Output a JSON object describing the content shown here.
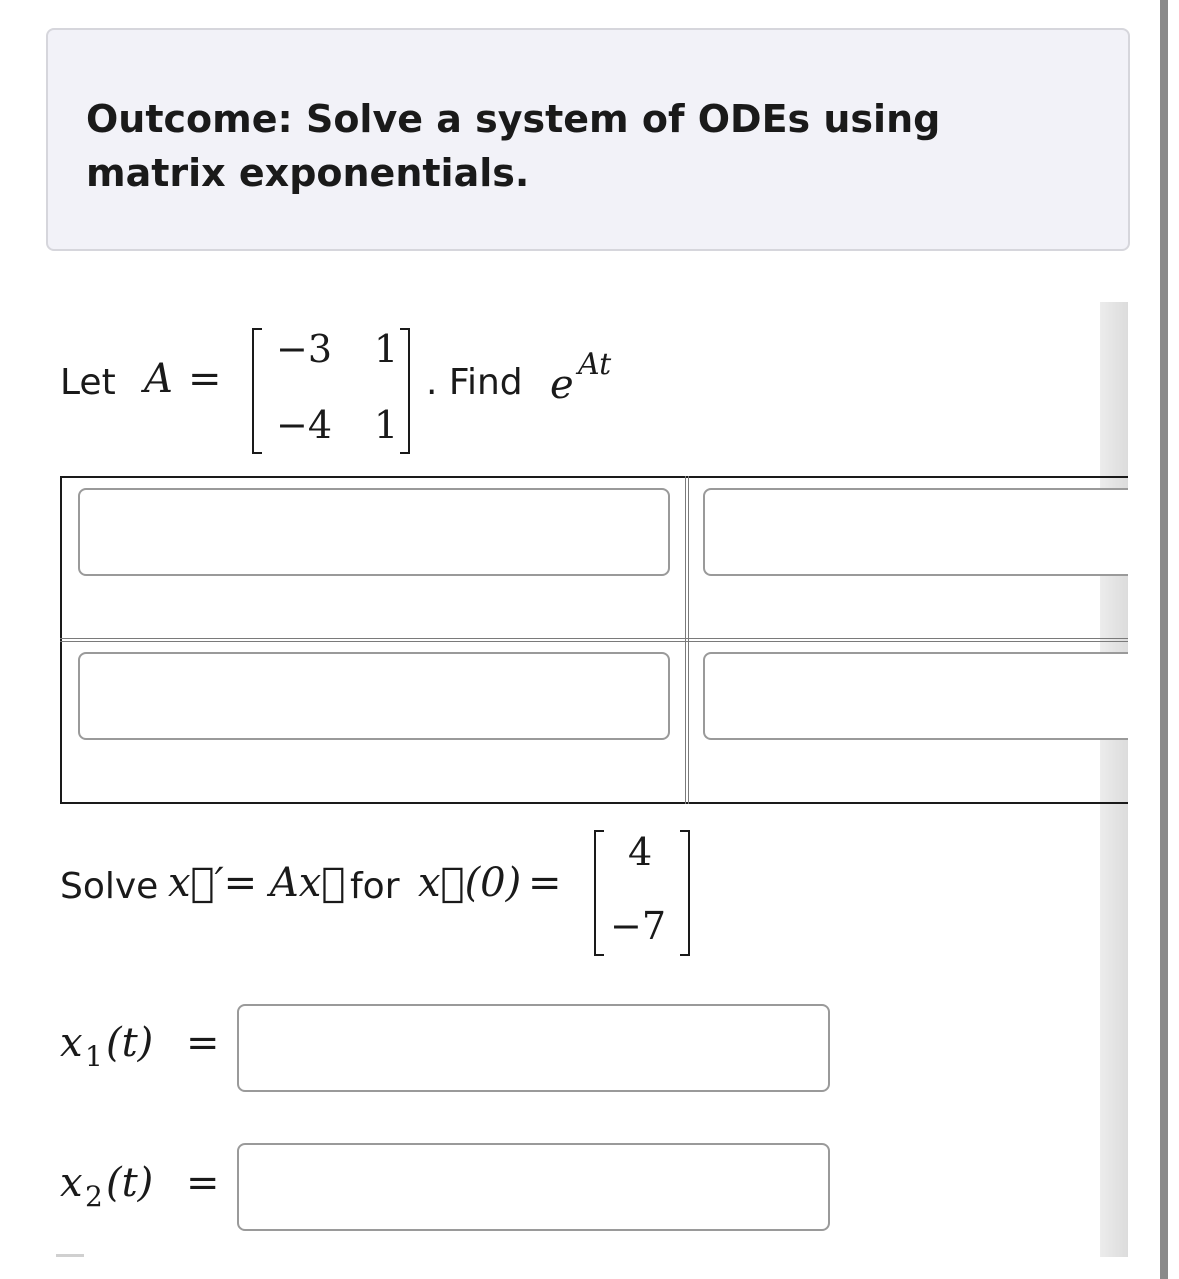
{
  "outcome": {
    "text": "Outcome: Solve a system of ODEs using matrix exponentials."
  },
  "question1": {
    "let_word": "Let",
    "matrix_name": "A",
    "equals": "=",
    "matrix": [
      [
        "−3",
        "1"
      ],
      [
        "−4",
        "1"
      ]
    ],
    "find_text": ". Find",
    "exp_base": "e",
    "exp_power": "At"
  },
  "answer_matrix": {
    "cells": [
      {
        "value": "",
        "placeholder": ""
      },
      {
        "value": "",
        "placeholder": ""
      },
      {
        "value": "",
        "placeholder": ""
      },
      {
        "value": "",
        "placeholder": ""
      }
    ]
  },
  "question2": {
    "solve_word": "Solve",
    "equation": "x⃗′= Ax⃗",
    "for_word": "for",
    "initial": "x⃗(0)",
    "equals": "=",
    "vector": [
      "4",
      "−7"
    ]
  },
  "answers": {
    "x1": {
      "label": "x",
      "sub": "1",
      "arg": "(t)",
      "equals": "=",
      "value": ""
    },
    "x2": {
      "label": "x",
      "sub": "2",
      "arg": "(t)",
      "equals": "=",
      "value": ""
    }
  }
}
